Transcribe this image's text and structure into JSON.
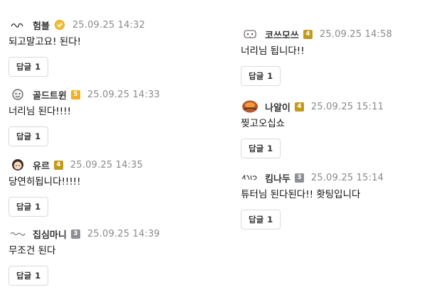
{
  "colors": {
    "badge_orange": "#f1b01f",
    "badge_gold": "#c49a1c",
    "badge_gray": "#8d8f94",
    "timestamp": "#8a8a8a",
    "border": "#dadada"
  },
  "comments": [
    {
      "nickname": "험블",
      "badge": "",
      "badge_icon": "gold-medal-icon",
      "time": "25.09.25 14:32",
      "text": "되고말고요! 된다!",
      "reply_label": "답글",
      "reply_count": "1"
    },
    {
      "nickname": "골드트윈",
      "badge": "5",
      "time": "25.09.25 14:33",
      "text": "너리님 된다!!!!",
      "reply_label": "답글",
      "reply_count": "1"
    },
    {
      "nickname": "유르",
      "badge": "4",
      "time": "25.09.25 14:35",
      "text": "당연히됩니다!!!!!",
      "reply_label": "답글",
      "reply_count": "1"
    },
    {
      "nickname": "집심마니",
      "badge": "3",
      "time": "25.09.25 14:39",
      "text": "무조건 된다",
      "reply_label": "답글",
      "reply_count": "1"
    },
    {
      "nickname": "코쓰모쓰",
      "badge": "4",
      "time": "25.09.25 14:58",
      "text": "너리님 됩니다!!",
      "reply_label": "답글",
      "reply_count": "1"
    },
    {
      "nickname": "나알이",
      "badge": "4",
      "time": "25.09.25 15:11",
      "text": "찢고오십쇼",
      "reply_label": "답글",
      "reply_count": "1"
    },
    {
      "nickname": "킴나두",
      "badge": "3",
      "time": "25.09.25 15:14",
      "text": "튜터님 된다된다!! 홧팅입니다",
      "reply_label": "답글",
      "reply_count": "1"
    }
  ]
}
